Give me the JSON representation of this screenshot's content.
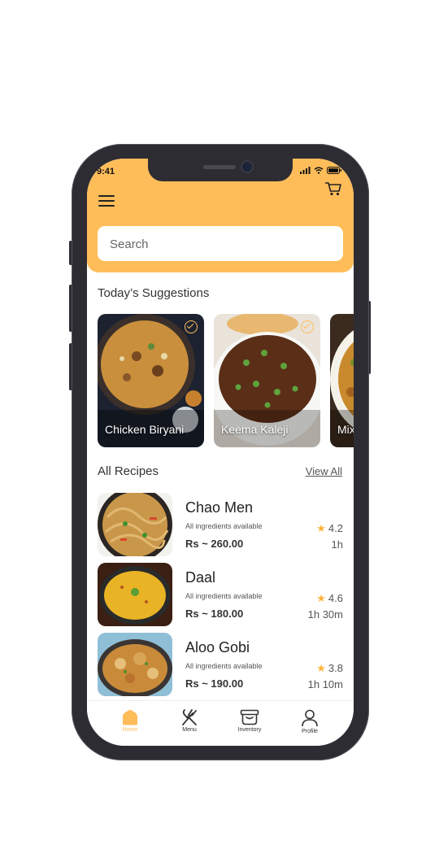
{
  "status_bar": {
    "time": "9:41"
  },
  "search": {
    "placeholder": "Search"
  },
  "suggestions": {
    "title": "Today’s Suggestions",
    "items": [
      {
        "label": "Chicken Biryani",
        "checked": true
      },
      {
        "label": "Keema Kaleji",
        "checked": true
      },
      {
        "label": "Mix",
        "checked": false
      }
    ]
  },
  "recipes": {
    "title": "All Recipes",
    "view_all": "View All",
    "items": [
      {
        "name": "Chao Men",
        "availability": "All ingredients available",
        "price": "Rs ~ 260.00",
        "rating": "4.2",
        "duration": "1h"
      },
      {
        "name": "Daal",
        "availability": "All ingredients available",
        "price": "Rs ~ 180.00",
        "rating": "4.6",
        "duration": "1h 30m"
      },
      {
        "name": "Aloo Gobi",
        "availability": "All ingredients available",
        "price": "Rs ~ 190.00",
        "rating": "3.8",
        "duration": "1h 10m"
      }
    ]
  },
  "tabs": [
    {
      "label": "Home",
      "icon": "home-icon",
      "active": true
    },
    {
      "label": "Menu",
      "icon": "utensils-icon",
      "active": false
    },
    {
      "label": "Inventory",
      "icon": "inventory-icon",
      "active": false
    },
    {
      "label": "Profile",
      "icon": "profile-icon",
      "active": false
    }
  ],
  "colors": {
    "accent": "#ffbd59",
    "star": "#ffb53b",
    "frame": "#2d2c33"
  }
}
